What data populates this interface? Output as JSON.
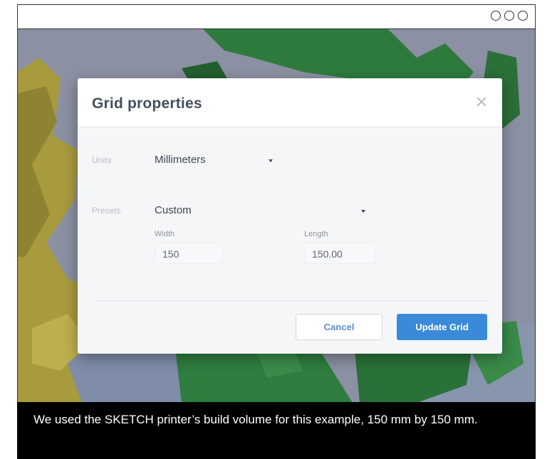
{
  "window": {
    "controls": [
      "circle-icon",
      "circle-icon",
      "circle-icon"
    ]
  },
  "dialog": {
    "title": "Grid properties",
    "close_icon": "close-icon",
    "units": {
      "label": "Units",
      "value": "Millimeters"
    },
    "presets": {
      "label": "Presets",
      "value": "Custom"
    },
    "width": {
      "label": "Width",
      "value": "150"
    },
    "length": {
      "label": "Length",
      "value": "150.00"
    },
    "cancel_label": "Cancel",
    "update_label": "Update Grid"
  },
  "caption": {
    "text": "We used the SKETCH printer’s build volume for this example, 150 mm by 150 mm."
  },
  "colors": {
    "accent": "#3b8ad9",
    "model_green": "#2f7a3e",
    "model_yellow": "#a69a3c",
    "viewport_bg": "#8a8fa1"
  }
}
